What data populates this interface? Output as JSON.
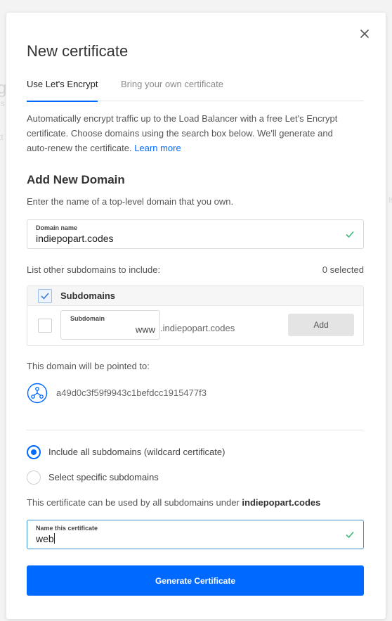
{
  "background": {
    "fragments": [
      "g",
      "ls",
      "tt",
      "ls"
    ]
  },
  "modal": {
    "title": "New certificate",
    "close_icon": "close-icon",
    "tabs": [
      {
        "label": "Use Let's Encrypt",
        "active": true
      },
      {
        "label": "Bring your own certificate",
        "active": false
      }
    ],
    "description": "Automatically encrypt traffic up to the Load Balancer with a free Let's Encrypt certificate. Choose domains using the search box below. We'll generate and auto-renew the certificate.",
    "learn_more": "Learn more"
  },
  "add_domain": {
    "heading": "Add New Domain",
    "subheading": "Enter the name of a top-level domain that you own.",
    "domain_field": {
      "label": "Domain name",
      "value": "indiepopart.codes",
      "valid": true
    }
  },
  "subdomains": {
    "list_label": "List other subdomains to include:",
    "selected_count": "0 selected",
    "header_label": "Subdomains",
    "header_checked": true,
    "row": {
      "checked": false,
      "input_label": "Subdomain",
      "input_value": "www",
      "suffix": ".indiepopart.codes",
      "add_label": "Add"
    }
  },
  "pointing": {
    "label": "This domain will be pointed to:",
    "icon": "load-balancer-icon",
    "target_id": "a49d0c3f59f9943c1befdcc1915477f3"
  },
  "scope": {
    "options": [
      {
        "label": "Include all subdomains (wildcard certificate)",
        "selected": true
      },
      {
        "label": "Select specific subdomains",
        "selected": false
      }
    ],
    "usage_prefix": "This certificate can be used by all subdomains under",
    "usage_domain": "indiepopart.codes"
  },
  "name_field": {
    "label": "Name this certificate",
    "value": "web",
    "valid": true
  },
  "generate_button": "Generate Certificate",
  "colors": {
    "accent": "#0069ff",
    "valid_check": "#3cb878",
    "border": "#d9d9d9"
  }
}
